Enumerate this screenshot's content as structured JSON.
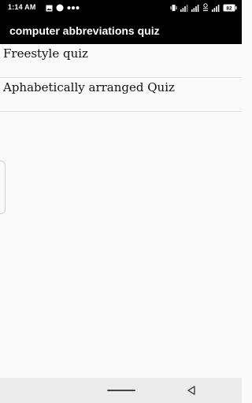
{
  "status_bar": {
    "time": "1:14 AM",
    "left_icons": [
      "gallery-icon",
      "circle-icon",
      "more-dots-icon"
    ],
    "right_icons": [
      "vibrate-icon",
      "signal-icon",
      "signal-icon",
      "data-speed-icon",
      "signal-icon",
      "battery-icon"
    ],
    "battery_level": "82"
  },
  "app_bar": {
    "title": "computer abbreviations quiz"
  },
  "menu": {
    "items": [
      {
        "label": "Freestyle quiz"
      },
      {
        "label": "Aphabetically arranged Quiz"
      }
    ]
  },
  "nav_bar": {
    "icons": [
      "home-pill-icon",
      "back-triangle-icon"
    ]
  }
}
